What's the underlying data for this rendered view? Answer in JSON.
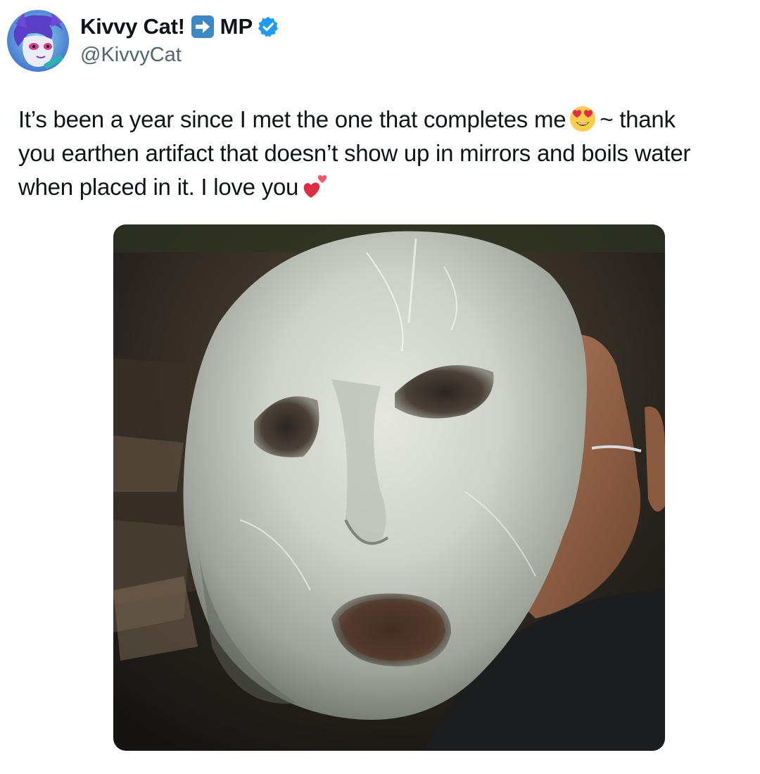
{
  "tweet": {
    "author": {
      "display_name": "Kivvy Cat!",
      "name_suffix": "MP",
      "handle": "@KivvyCat",
      "name_emoji": "right-arrow-emoji",
      "verified": true,
      "verified_color": "#1d9bf0"
    },
    "text_lines": [
      "It’s been a year since I met the one that completes me",
      "~ thank",
      "you earthen artifact that doesn’t show up in mirrors and boils water",
      "when placed in it. I love you"
    ],
    "text_emojis": [
      "smiling-face-with-heart-eyes-emoji",
      "two-hearts-emoji"
    ],
    "media": {
      "type": "photo",
      "subject": "pale stone shaped like a screaming face held in a hand"
    }
  }
}
